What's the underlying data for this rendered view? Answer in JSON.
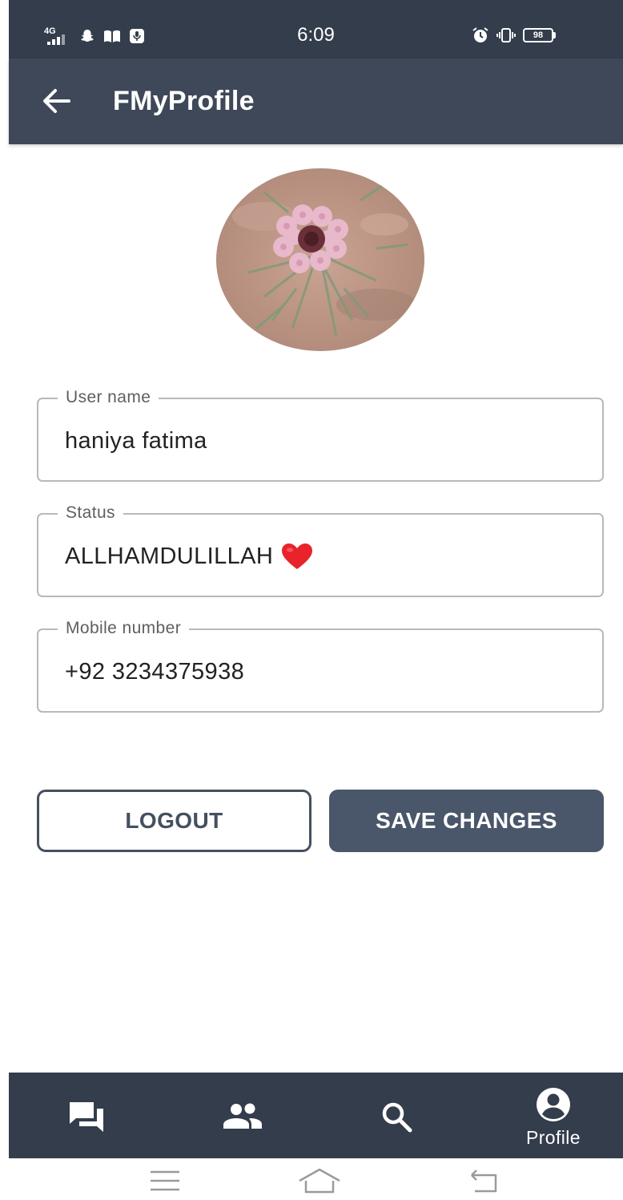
{
  "status_bar": {
    "network": "4G",
    "time": "6:09",
    "battery": "98"
  },
  "app_bar": {
    "title": "FMyProfile"
  },
  "profile": {
    "username_label": "User name",
    "username_value": "haniya fatima",
    "status_label": "Status",
    "status_value": "ALLHAMDULILLAH",
    "status_emoji": "heart-emoji",
    "mobile_label": "Mobile number",
    "mobile_value": "+92 3234375938"
  },
  "actions": {
    "logout_label": "LOGOUT",
    "save_label": "SAVE CHANGES"
  },
  "bottom_nav": {
    "items": [
      {
        "icon": "chats-icon",
        "label": ""
      },
      {
        "icon": "people-icon",
        "label": ""
      },
      {
        "icon": "search-icon",
        "label": ""
      },
      {
        "icon": "account-circle-icon",
        "label": "Profile",
        "active": true
      }
    ]
  },
  "colors": {
    "status_bar": "#333d4c",
    "app_bar": "#3e4859",
    "primary_button": "#4a5669",
    "outline_button": "#44505f",
    "heart": "#e8232b"
  }
}
